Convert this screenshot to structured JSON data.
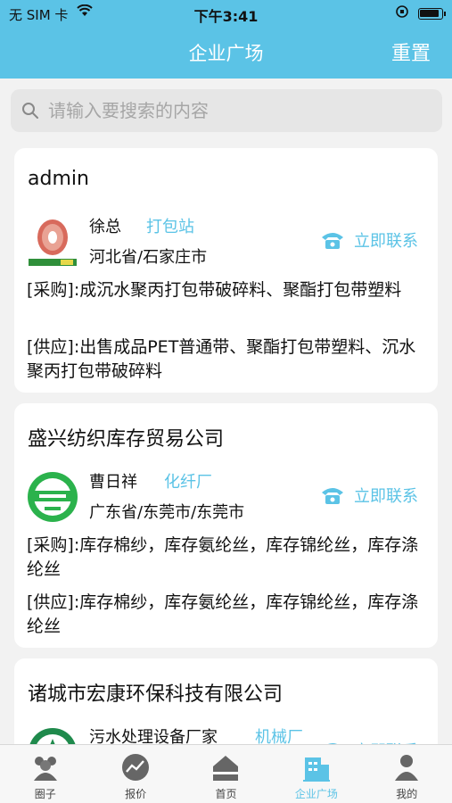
{
  "status_bar": {
    "carrier": "无 SIM 卡",
    "time": "下午3:41"
  },
  "nav": {
    "title": "企业广场",
    "reset_label": "重置"
  },
  "search": {
    "placeholder": "请输入要搜索的内容"
  },
  "companies": [
    {
      "name": "admin",
      "contact": "徐总",
      "tag": "打包站",
      "region": "河北省/石家庄市",
      "action": "立即联系",
      "purchase": "[采购]:成沉水聚丙打包带破碎料、聚酯打包带塑料",
      "supply": "[供应]:出售成品PET普通带、聚酯打包带塑料、沉水聚丙打包带破碎料"
    },
    {
      "name": "盛兴纺织库存贸易公司",
      "contact": "曹日祥",
      "tag": "化纤厂",
      "region": "广东省/东莞市/东莞市",
      "action": "立即联系",
      "purchase": "[采购]:库存棉纱，库存氨纶丝，库存锦纶丝，库存涤纶丝",
      "supply": "[供应]:库存棉纱，库存氨纶丝，库存锦纶丝，库存涤纶丝"
    },
    {
      "name": "诸城市宏康环保科技有限公司",
      "contact": "污水处理设备厂家",
      "tag": "机械厂",
      "action": "立即联系"
    }
  ],
  "tabs": [
    {
      "label": "圈子",
      "icon": "group-icon"
    },
    {
      "label": "报价",
      "icon": "trend-icon"
    },
    {
      "label": "首页",
      "icon": "home-icon"
    },
    {
      "label": "企业广场",
      "icon": "building-icon",
      "active": true
    },
    {
      "label": "我的",
      "icon": "person-icon"
    }
  ],
  "colors": {
    "accent": "#5bc3e6",
    "background": "#f2f2f2"
  }
}
